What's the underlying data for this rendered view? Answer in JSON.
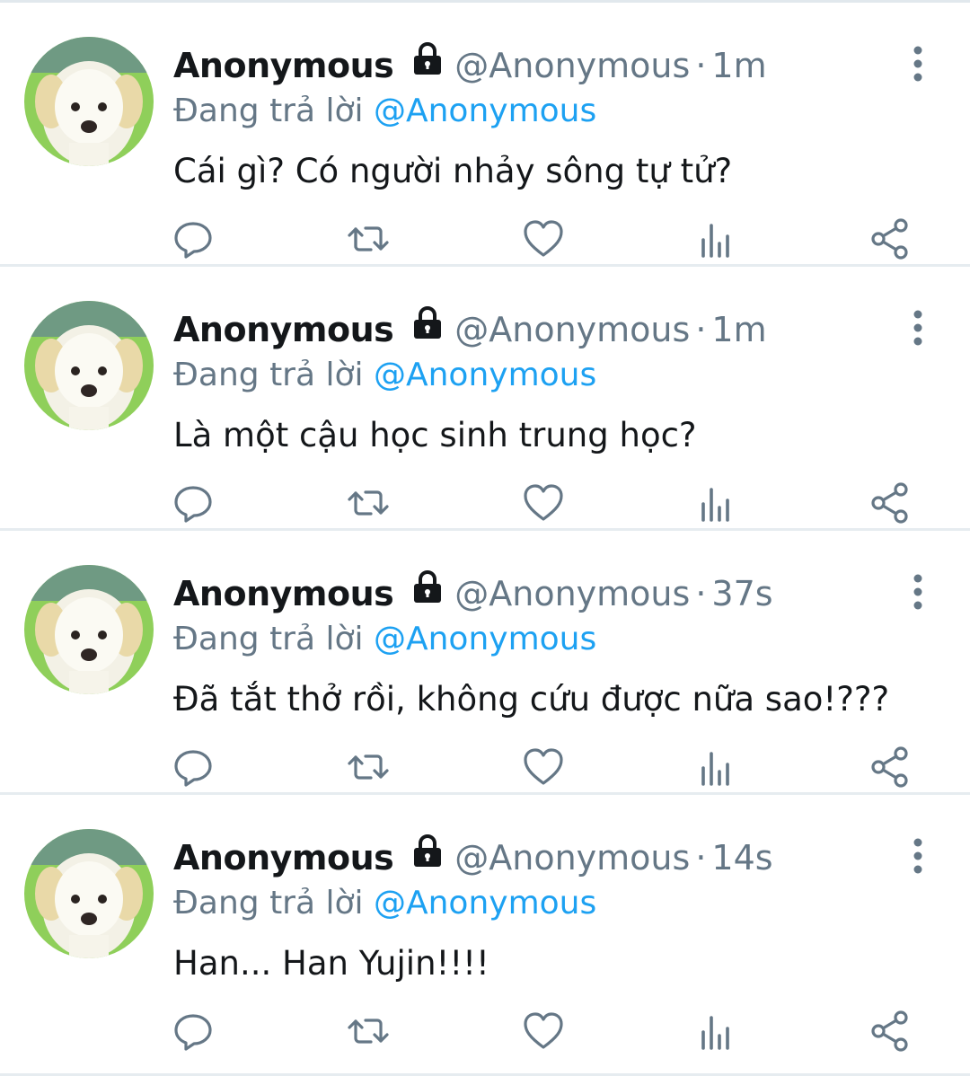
{
  "tweets": [
    {
      "name": "Anonymous",
      "handle": "@Anonymous",
      "separator": "·",
      "time": "1m",
      "reply_prefix": "Đang trả lời",
      "reply_handle": "@Anonymous",
      "text": "Cái gì? Có người nhảy sông tự tử?"
    },
    {
      "name": "Anonymous",
      "handle": "@Anonymous",
      "separator": "·",
      "time": "1m",
      "reply_prefix": "Đang trả lời",
      "reply_handle": "@Anonymous",
      "text": "Là một cậu học sinh trung học?"
    },
    {
      "name": "Anonymous",
      "handle": "@Anonymous",
      "separator": "·",
      "time": "37s",
      "reply_prefix": "Đang trả lời",
      "reply_handle": "@Anonymous",
      "text": "Đã tắt thở rồi, không cứu được nữa sao!???"
    },
    {
      "name": "Anonymous",
      "handle": "@Anonymous",
      "separator": "·",
      "time": "14s",
      "reply_prefix": "Đang trả lời",
      "reply_handle": "@Anonymous",
      "text": "Han... Han Yujin!!!!"
    }
  ],
  "icons": {
    "avatar": "puppy-avatar",
    "protected": "lock-icon",
    "more": "more-vertical-icon",
    "reply": "reply-icon",
    "retweet": "retweet-icon",
    "like": "heart-icon",
    "stats": "analytics-icon",
    "share": "share-icon"
  },
  "colors": {
    "text": "#14171a",
    "secondary": "#657786",
    "link": "#1da1f2",
    "divider": "#e6ecf0",
    "icon": "#657786"
  }
}
